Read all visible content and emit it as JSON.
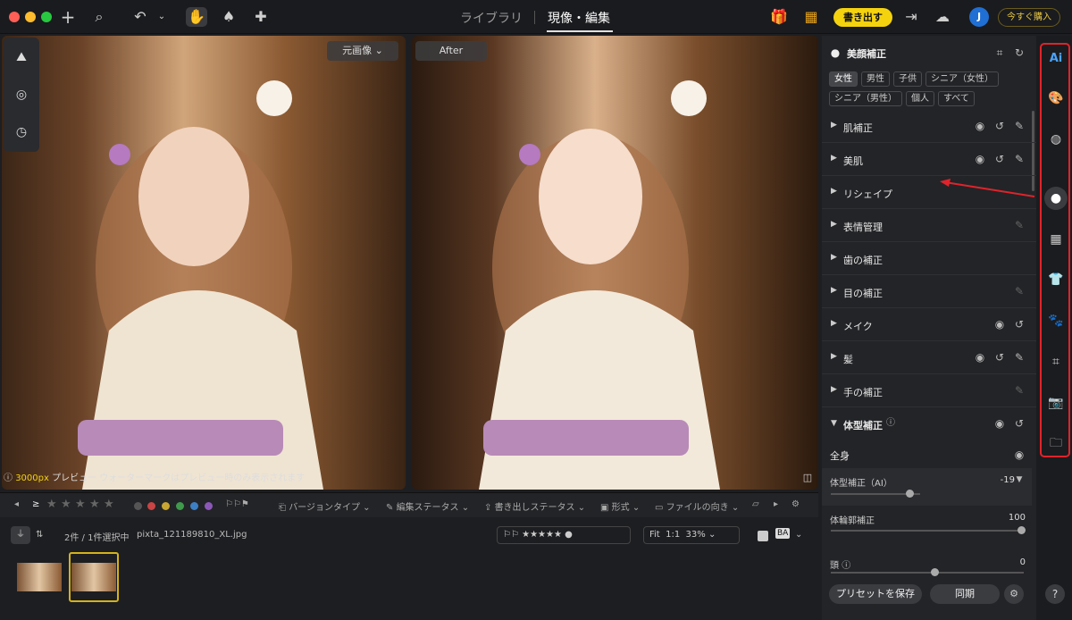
{
  "topbar": {
    "tabs": [
      {
        "label": "ライブラリ"
      },
      {
        "label": "現像・編集"
      }
    ],
    "export_label": "書き出す",
    "buy_label": "今すぐ購入",
    "avatar_initial": "J"
  },
  "viewer": {
    "before_label": "元画像",
    "after_label": "After",
    "preview_size": "3000px",
    "preview_note": " プレビュー ウォーターマークはプレビュー時のみ表示されます"
  },
  "filterbar": {
    "version_type": "バージョンタイプ",
    "edit_status": "編集ステータス",
    "export_status": "書き出しステータス",
    "format": "形式",
    "orientation": "ファイルの向き",
    "rating_op": "≥"
  },
  "infobar": {
    "selection": "2件 / 1件選択中",
    "filename": "pixta_121189810_XL.jpg",
    "zoom_fit": "Fit",
    "zoom_1to1": "1:1",
    "zoom_value": "33%"
  },
  "panel": {
    "title": "美顔補正",
    "chips": [
      "女性",
      "男性",
      "子供",
      "シニア（女性）",
      "シニア（男性）",
      "個人",
      "すべて"
    ],
    "sections": [
      {
        "label": "肌補正"
      },
      {
        "label": "美肌"
      },
      {
        "label": "リシェイプ"
      },
      {
        "label": "表情管理"
      },
      {
        "label": "歯の補正"
      },
      {
        "label": "目の補正"
      },
      {
        "label": "メイク"
      },
      {
        "label": "髪"
      },
      {
        "label": "手の補正"
      },
      {
        "label": "体型補正"
      }
    ],
    "subheader": "全身",
    "sliders": [
      {
        "label": "体型補正（AI）",
        "value": "-19"
      },
      {
        "label": "体輪郭補正",
        "value": "100"
      },
      {
        "label": "頭",
        "value": "0"
      }
    ],
    "save_preset": "プリセットを保存",
    "sync": "同期"
  },
  "colors": {
    "accent_yellow": "#f4d20e",
    "highlight_red": "#e0232b",
    "avatar_blue": "#1f6fd4"
  }
}
